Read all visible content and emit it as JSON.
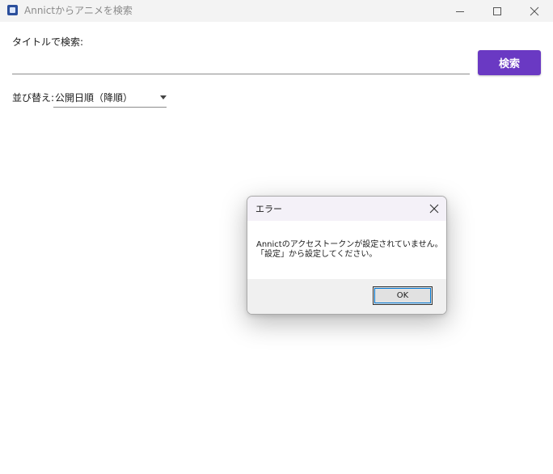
{
  "window": {
    "title": "Annictからアニメを検索",
    "app_icon": "annict-app-icon",
    "controls": [
      "minimize-icon",
      "maximize-icon",
      "close-icon"
    ]
  },
  "search": {
    "label": "タイトルで検索:",
    "value": "",
    "placeholder": "",
    "button_label": "検索",
    "button_color": "#6a39c3"
  },
  "sort": {
    "label": "並び替え:",
    "selected": "公開日順（降順）"
  },
  "dialog": {
    "title": "エラー",
    "message_line1": "Annictのアクセストークンが設定されていません。",
    "message_line2": "「設定」から設定してください。",
    "ok_label": "OK"
  }
}
